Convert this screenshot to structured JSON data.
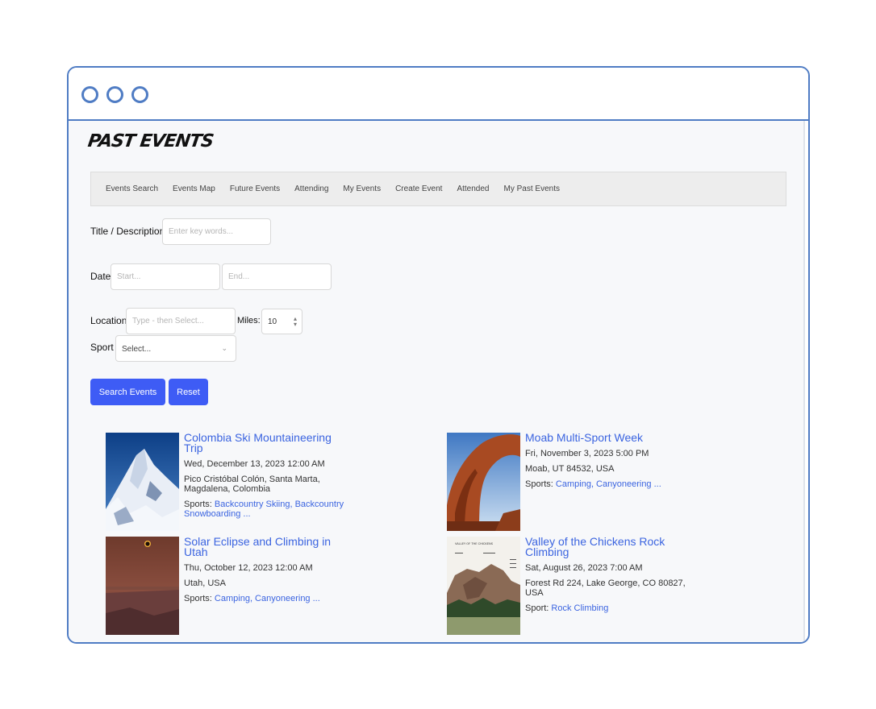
{
  "page": {
    "title": "PAST EVENTS"
  },
  "nav": {
    "items": [
      "Events Search",
      "Events Map",
      "Future Events",
      "Attending",
      "My Events",
      "Create Event",
      "Attended",
      "My Past Events"
    ]
  },
  "filters": {
    "title_label": "Title / Description",
    "title_placeholder": "Enter key words...",
    "date_label": "Date",
    "start_placeholder": "Start...",
    "end_placeholder": "End...",
    "location_label": "Location",
    "location_placeholder": "Type - then Select...",
    "miles_label": "Miles:",
    "miles_value": "10",
    "sport_label": "Sport",
    "sport_value": "Select..."
  },
  "buttons": {
    "search": "Search Events",
    "reset": "Reset"
  },
  "events": [
    {
      "title": "Colombia Ski Mountaineering Trip",
      "date": "Wed, December 13, 2023 12:00 AM",
      "location": "Pico Cristóbal Colón, Santa Marta, Magdalena, Colombia",
      "sports_label": "Sports:",
      "sports": "Backcountry Skiing, Backcountry Snowboarding ..."
    },
    {
      "title": "Moab Multi-Sport Week",
      "date": "Fri, November 3, 2023 5:00 PM",
      "location": "Moab, UT 84532, USA",
      "sports_label": "Sports:",
      "sports": "Camping, Canyoneering ..."
    },
    {
      "title": "Solar Eclipse and Climbing in Utah",
      "date": "Thu, October 12, 2023 12:00 AM",
      "location": "Utah, USA",
      "sports_label": "Sports:",
      "sports": "Camping, Canyoneering ..."
    },
    {
      "title": "Valley of the Chickens Rock Climbing",
      "date": "Sat, August 26, 2023 7:00 AM",
      "location": "Forest Rd 224, Lake George, CO 80827, USA",
      "sports_label": "Sport:",
      "sports": "Rock Climbing",
      "image_text": "VALLEY OF THE CHICKENS"
    }
  ],
  "colors": {
    "accent": "#3e5cf5",
    "link": "#3b64e0",
    "frame": "#4f7cc4"
  }
}
